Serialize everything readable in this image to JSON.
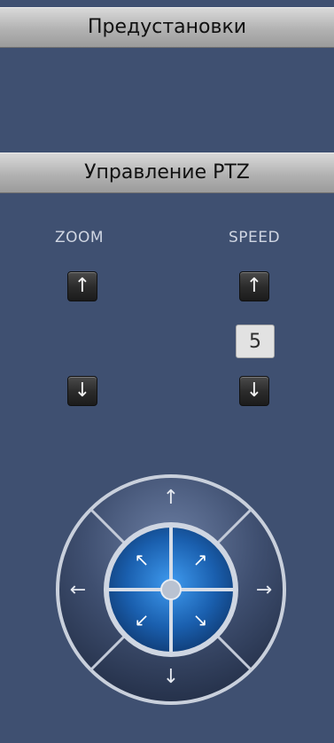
{
  "panels": {
    "presets_title": "Предустановки",
    "ptz_title": "Управление PTZ"
  },
  "zoom": {
    "label": "ZOOM",
    "up_icon": "arrow-up-icon",
    "down_icon": "arrow-down-icon"
  },
  "speed": {
    "label": "SPEED",
    "value": "5",
    "up_icon": "arrow-up-icon",
    "down_icon": "arrow-down-icon"
  },
  "colors": {
    "background": "#3f5071",
    "header_bar": "#b8b8b8",
    "joystick_inner": "#1f67b5",
    "joystick_outer": "#3c4c6c"
  }
}
